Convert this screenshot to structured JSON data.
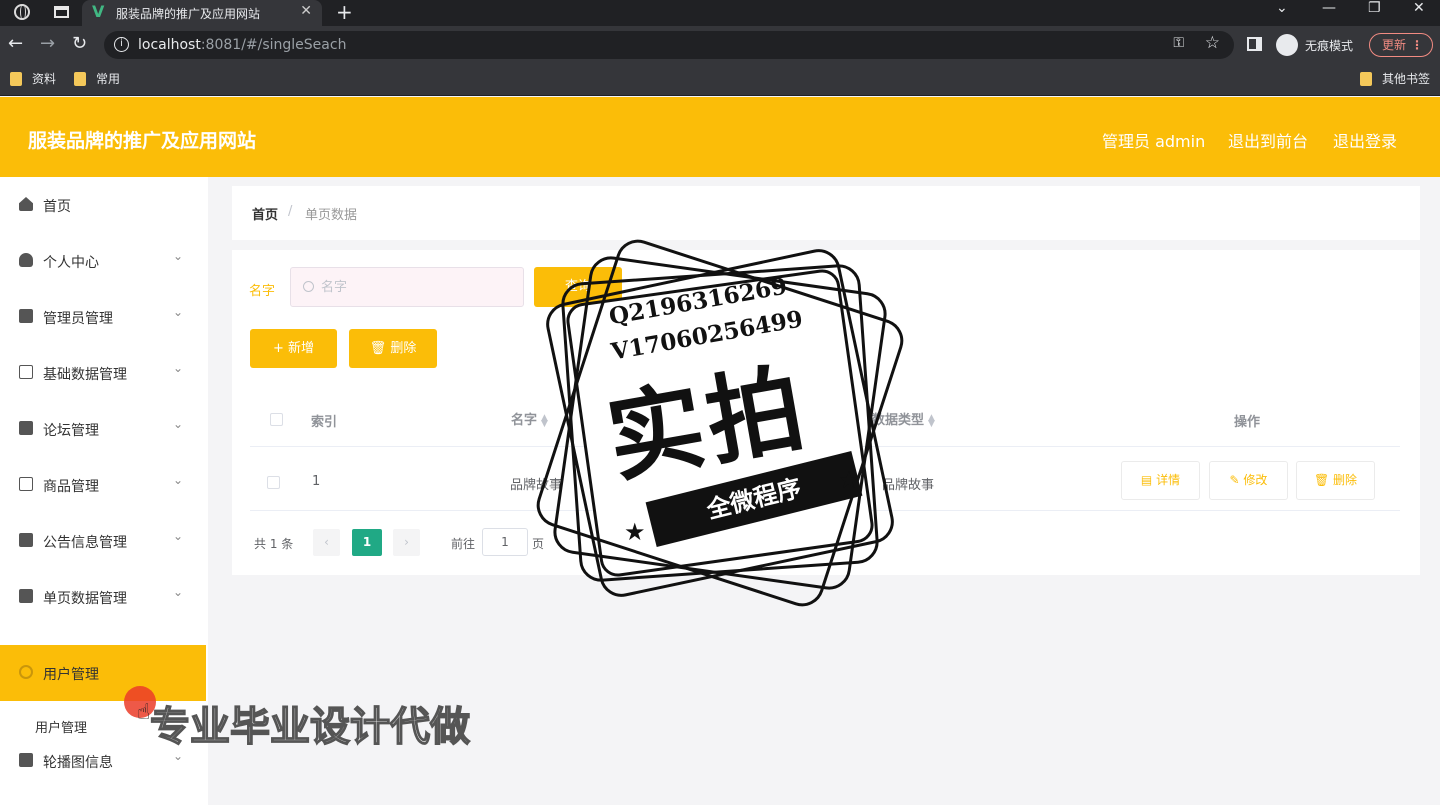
{
  "browser": {
    "tab_title": "服装品牌的推广及应用网站",
    "tab_logo": "V",
    "url_host": "localhost",
    "url_rest": ":8081/#/singleSeach",
    "incognito_label": "无痕模式",
    "update_label": "更新",
    "bookmarks": [
      "资料",
      "常用"
    ],
    "other_bookmarks": "其他书签"
  },
  "header": {
    "title": "服装品牌的推广及应用网站",
    "links": [
      "管理员 admin",
      "退出到前台",
      "退出登录"
    ]
  },
  "sidebar": {
    "items": [
      {
        "label": "首页",
        "icon": "home-icon"
      },
      {
        "label": "个人中心",
        "icon": "user-icon"
      },
      {
        "label": "管理员管理",
        "icon": "briefcase-icon"
      },
      {
        "label": "基础数据管理",
        "icon": "mail-icon"
      },
      {
        "label": "论坛管理",
        "icon": "clipboard-icon"
      },
      {
        "label": "商品管理",
        "icon": "chat-icon"
      },
      {
        "label": "公告信息管理",
        "icon": "checklist-icon"
      },
      {
        "label": "单页数据管理",
        "icon": "monitor-icon"
      },
      {
        "label": "用户管理",
        "icon": "settings-icon"
      },
      {
        "label": "轮播图信息",
        "icon": "image-icon"
      }
    ],
    "sub_item": "用户管理"
  },
  "breadcrumb": {
    "home": "首页",
    "separator": "/",
    "current": "单页数据"
  },
  "search": {
    "label": "名字",
    "placeholder": "名字",
    "button": "查询"
  },
  "actions": {
    "add": "+ 新增",
    "delete": "删除"
  },
  "table": {
    "columns": [
      "索引",
      "名字",
      "数据类型",
      "操作"
    ],
    "rows": [
      {
        "index": "1",
        "name": "品牌故事",
        "type": "品牌故事"
      }
    ],
    "row_actions": [
      "详情",
      "修改",
      "删除"
    ]
  },
  "pagination": {
    "total": "共 1 条",
    "current": "1",
    "goto": "前往",
    "page_input": "1",
    "page_unit": "页"
  },
  "watermark": {
    "line1": "Q2196316269",
    "line2": "V17060256499",
    "big": "实拍",
    "ribbon": "全微程序",
    "promo": "专业毕业设计代做"
  },
  "colors": {
    "accent": "#fbbd08",
    "pager_active": "#20a985",
    "chrome_dark": "#202124"
  }
}
